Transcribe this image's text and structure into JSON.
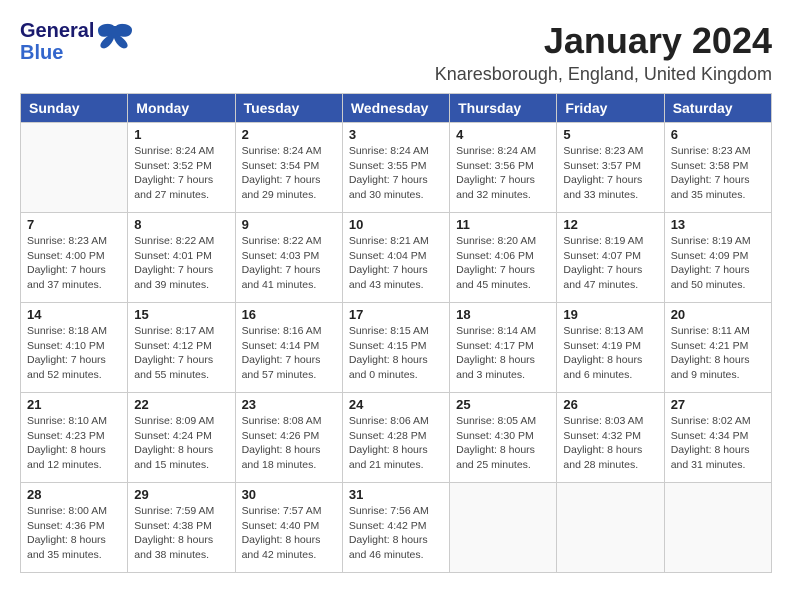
{
  "header": {
    "logo_general": "General",
    "logo_blue": "Blue",
    "month": "January 2024",
    "location": "Knaresborough, England, United Kingdom"
  },
  "days_of_week": [
    "Sunday",
    "Monday",
    "Tuesday",
    "Wednesday",
    "Thursday",
    "Friday",
    "Saturday"
  ],
  "weeks": [
    [
      {
        "day": "",
        "sunrise": "",
        "sunset": "",
        "daylight": ""
      },
      {
        "day": "1",
        "sunrise": "Sunrise: 8:24 AM",
        "sunset": "Sunset: 3:52 PM",
        "daylight": "Daylight: 7 hours and 27 minutes."
      },
      {
        "day": "2",
        "sunrise": "Sunrise: 8:24 AM",
        "sunset": "Sunset: 3:54 PM",
        "daylight": "Daylight: 7 hours and 29 minutes."
      },
      {
        "day": "3",
        "sunrise": "Sunrise: 8:24 AM",
        "sunset": "Sunset: 3:55 PM",
        "daylight": "Daylight: 7 hours and 30 minutes."
      },
      {
        "day": "4",
        "sunrise": "Sunrise: 8:24 AM",
        "sunset": "Sunset: 3:56 PM",
        "daylight": "Daylight: 7 hours and 32 minutes."
      },
      {
        "day": "5",
        "sunrise": "Sunrise: 8:23 AM",
        "sunset": "Sunset: 3:57 PM",
        "daylight": "Daylight: 7 hours and 33 minutes."
      },
      {
        "day": "6",
        "sunrise": "Sunrise: 8:23 AM",
        "sunset": "Sunset: 3:58 PM",
        "daylight": "Daylight: 7 hours and 35 minutes."
      }
    ],
    [
      {
        "day": "7",
        "sunrise": "Sunrise: 8:23 AM",
        "sunset": "Sunset: 4:00 PM",
        "daylight": "Daylight: 7 hours and 37 minutes."
      },
      {
        "day": "8",
        "sunrise": "Sunrise: 8:22 AM",
        "sunset": "Sunset: 4:01 PM",
        "daylight": "Daylight: 7 hours and 39 minutes."
      },
      {
        "day": "9",
        "sunrise": "Sunrise: 8:22 AM",
        "sunset": "Sunset: 4:03 PM",
        "daylight": "Daylight: 7 hours and 41 minutes."
      },
      {
        "day": "10",
        "sunrise": "Sunrise: 8:21 AM",
        "sunset": "Sunset: 4:04 PM",
        "daylight": "Daylight: 7 hours and 43 minutes."
      },
      {
        "day": "11",
        "sunrise": "Sunrise: 8:20 AM",
        "sunset": "Sunset: 4:06 PM",
        "daylight": "Daylight: 7 hours and 45 minutes."
      },
      {
        "day": "12",
        "sunrise": "Sunrise: 8:19 AM",
        "sunset": "Sunset: 4:07 PM",
        "daylight": "Daylight: 7 hours and 47 minutes."
      },
      {
        "day": "13",
        "sunrise": "Sunrise: 8:19 AM",
        "sunset": "Sunset: 4:09 PM",
        "daylight": "Daylight: 7 hours and 50 minutes."
      }
    ],
    [
      {
        "day": "14",
        "sunrise": "Sunrise: 8:18 AM",
        "sunset": "Sunset: 4:10 PM",
        "daylight": "Daylight: 7 hours and 52 minutes."
      },
      {
        "day": "15",
        "sunrise": "Sunrise: 8:17 AM",
        "sunset": "Sunset: 4:12 PM",
        "daylight": "Daylight: 7 hours and 55 minutes."
      },
      {
        "day": "16",
        "sunrise": "Sunrise: 8:16 AM",
        "sunset": "Sunset: 4:14 PM",
        "daylight": "Daylight: 7 hours and 57 minutes."
      },
      {
        "day": "17",
        "sunrise": "Sunrise: 8:15 AM",
        "sunset": "Sunset: 4:15 PM",
        "daylight": "Daylight: 8 hours and 0 minutes."
      },
      {
        "day": "18",
        "sunrise": "Sunrise: 8:14 AM",
        "sunset": "Sunset: 4:17 PM",
        "daylight": "Daylight: 8 hours and 3 minutes."
      },
      {
        "day": "19",
        "sunrise": "Sunrise: 8:13 AM",
        "sunset": "Sunset: 4:19 PM",
        "daylight": "Daylight: 8 hours and 6 minutes."
      },
      {
        "day": "20",
        "sunrise": "Sunrise: 8:11 AM",
        "sunset": "Sunset: 4:21 PM",
        "daylight": "Daylight: 8 hours and 9 minutes."
      }
    ],
    [
      {
        "day": "21",
        "sunrise": "Sunrise: 8:10 AM",
        "sunset": "Sunset: 4:23 PM",
        "daylight": "Daylight: 8 hours and 12 minutes."
      },
      {
        "day": "22",
        "sunrise": "Sunrise: 8:09 AM",
        "sunset": "Sunset: 4:24 PM",
        "daylight": "Daylight: 8 hours and 15 minutes."
      },
      {
        "day": "23",
        "sunrise": "Sunrise: 8:08 AM",
        "sunset": "Sunset: 4:26 PM",
        "daylight": "Daylight: 8 hours and 18 minutes."
      },
      {
        "day": "24",
        "sunrise": "Sunrise: 8:06 AM",
        "sunset": "Sunset: 4:28 PM",
        "daylight": "Daylight: 8 hours and 21 minutes."
      },
      {
        "day": "25",
        "sunrise": "Sunrise: 8:05 AM",
        "sunset": "Sunset: 4:30 PM",
        "daylight": "Daylight: 8 hours and 25 minutes."
      },
      {
        "day": "26",
        "sunrise": "Sunrise: 8:03 AM",
        "sunset": "Sunset: 4:32 PM",
        "daylight": "Daylight: 8 hours and 28 minutes."
      },
      {
        "day": "27",
        "sunrise": "Sunrise: 8:02 AM",
        "sunset": "Sunset: 4:34 PM",
        "daylight": "Daylight: 8 hours and 31 minutes."
      }
    ],
    [
      {
        "day": "28",
        "sunrise": "Sunrise: 8:00 AM",
        "sunset": "Sunset: 4:36 PM",
        "daylight": "Daylight: 8 hours and 35 minutes."
      },
      {
        "day": "29",
        "sunrise": "Sunrise: 7:59 AM",
        "sunset": "Sunset: 4:38 PM",
        "daylight": "Daylight: 8 hours and 38 minutes."
      },
      {
        "day": "30",
        "sunrise": "Sunrise: 7:57 AM",
        "sunset": "Sunset: 4:40 PM",
        "daylight": "Daylight: 8 hours and 42 minutes."
      },
      {
        "day": "31",
        "sunrise": "Sunrise: 7:56 AM",
        "sunset": "Sunset: 4:42 PM",
        "daylight": "Daylight: 8 hours and 46 minutes."
      },
      {
        "day": "",
        "sunrise": "",
        "sunset": "",
        "daylight": ""
      },
      {
        "day": "",
        "sunrise": "",
        "sunset": "",
        "daylight": ""
      },
      {
        "day": "",
        "sunrise": "",
        "sunset": "",
        "daylight": ""
      }
    ]
  ]
}
